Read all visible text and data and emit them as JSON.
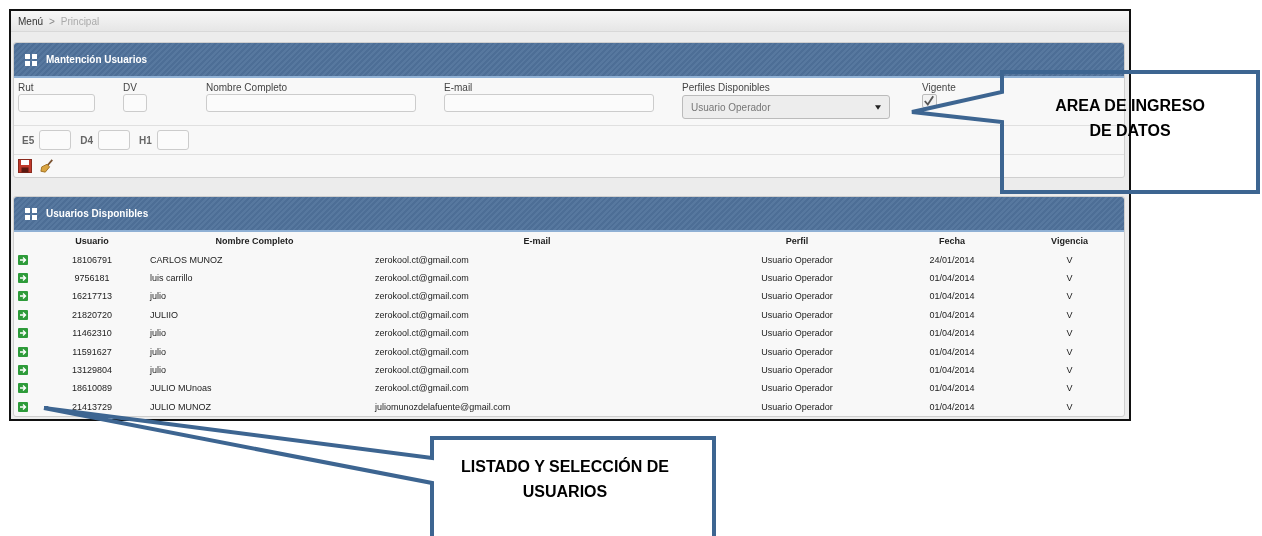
{
  "breadcrumb": [
    {
      "label": "Menú",
      "selected": true
    },
    {
      "label": "Principal",
      "selected": false
    }
  ],
  "breadcrumb_separator": ">",
  "form_panel": {
    "title": "Mantención Usuarios",
    "fields": [
      {
        "kind": "text",
        "label": "Rut"
      },
      {
        "kind": "text",
        "label": "DV"
      },
      {
        "kind": "text",
        "label": "Nombre Completo"
      },
      {
        "kind": "text",
        "label": "E-mail"
      },
      {
        "kind": "select",
        "label": "Perfiles Disponibles",
        "value": "Usuario Operador"
      },
      {
        "kind": "checkbox",
        "label": "Vigente",
        "checked": true
      }
    ],
    "small_fields": [
      {
        "label": "E5"
      },
      {
        "label": "D4"
      },
      {
        "label": "H1"
      }
    ]
  },
  "list_panel": {
    "title": "Usuarios Disponibles",
    "table": {
      "columns": [
        "Usuario",
        "Nombre Completo",
        "E-mail",
        "Perfil",
        "Fecha",
        "Vigencia"
      ],
      "rows": [
        [
          "18106791",
          "CARLOS MUNOZ",
          "zerokool.ct@gmail.com",
          "Usuario Operador",
          "24/01/2014",
          "V"
        ],
        [
          "9756181",
          "luis carrillo",
          "zerokool.ct@gmail.com",
          "Usuario Operador",
          "01/04/2014",
          "V"
        ],
        [
          "16217713",
          "julio",
          "zerokool.ct@gmail.com",
          "Usuario Operador",
          "01/04/2014",
          "V"
        ],
        [
          "21820720",
          "JULIIO",
          "zerokool.ct@gmail.com",
          "Usuario Operador",
          "01/04/2014",
          "V"
        ],
        [
          "11462310",
          "julio",
          "zerokool.ct@gmail.com",
          "Usuario Operador",
          "01/04/2014",
          "V"
        ],
        [
          "11591627",
          "julio",
          "zerokool.ct@gmail.com",
          "Usuario Operador",
          "01/04/2014",
          "V"
        ],
        [
          "13129804",
          "julio",
          "zerokool.ct@gmail.com",
          "Usuario Operador",
          "01/04/2014",
          "V"
        ],
        [
          "18610089",
          "JULIO MUnoas",
          "zerokool.ct@gmail.com",
          "Usuario Operador",
          "01/04/2014",
          "V"
        ],
        [
          "21413729",
          "JULIO MUNOZ",
          "juliomunozdelafuente@gmail.com",
          "Usuario Operador",
          "01/04/2014",
          "V"
        ]
      ]
    }
  },
  "callouts": [
    {
      "lines": [
        "AREA DE INGRESO",
        "DE DATOS"
      ]
    },
    {
      "lines": [
        "LISTADO Y SELECCIÓN DE",
        "USUARIOS"
      ]
    }
  ]
}
